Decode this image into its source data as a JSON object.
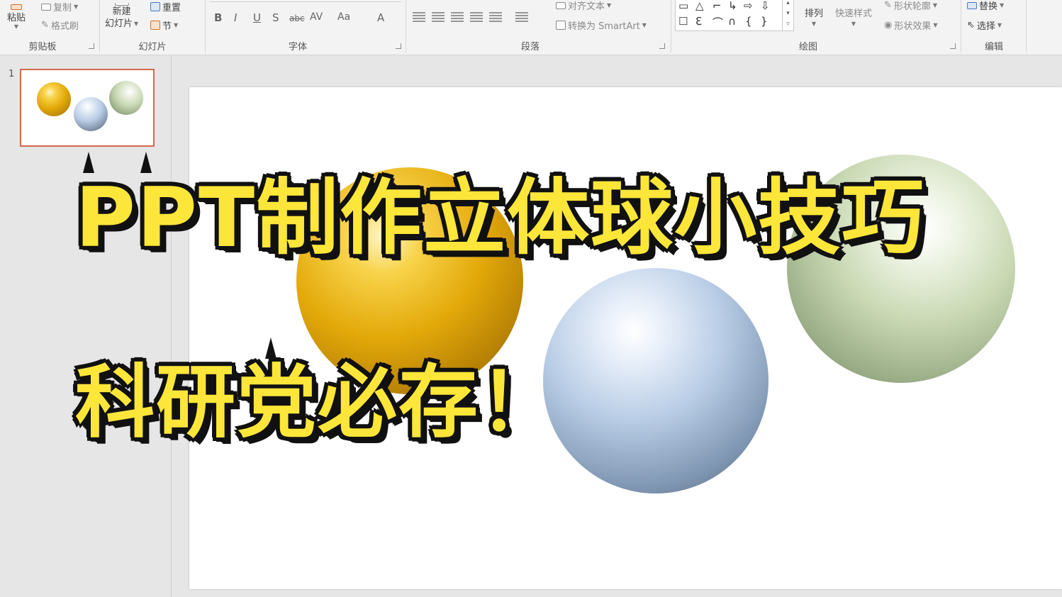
{
  "ribbon": {
    "clipboard": {
      "paste": "粘贴",
      "copy": "复制",
      "format_painter": "格式刷",
      "label": "剪贴板"
    },
    "slides": {
      "new_slide_line1": "新建",
      "new_slide_line2": "幻灯片",
      "reset": "重置",
      "section": "节",
      "label": "幻灯片"
    },
    "font": {
      "buttons": [
        "B",
        "I",
        "U",
        "S",
        "abc",
        "AV",
        "Aa",
        "A"
      ],
      "label": "字体"
    },
    "paragraph": {
      "align_text": "对齐文本",
      "convert_smartart": "转换为 SmartArt",
      "label": "段落"
    },
    "drawing": {
      "shapes_row1": [
        "▭",
        "△",
        "⌐",
        "↳",
        "⇨",
        "⇩"
      ],
      "shapes_row2": [
        "☐",
        "ℇ",
        "⌒",
        "∩",
        "{",
        "}"
      ],
      "arrange": "排列",
      "quick_styles": "快速样式",
      "shape_outline": "形状轮廓",
      "shape_effects": "形状效果",
      "label": "绘图"
    },
    "editing": {
      "replace": "替换",
      "select": "选择",
      "label": "编辑"
    }
  },
  "thumbnail_pane": {
    "slide_number": "1"
  },
  "colors": {
    "headline_fill": "#fde63a",
    "headline_stroke": "#111111",
    "thumb_selected_border": "#d2684f",
    "sphere_gold": "#e3a90a",
    "sphere_blue": "#b9cde6",
    "sphere_green": "#cad9b4"
  },
  "overlay": {
    "headline": "PPT制作立体球小技巧",
    "subline": "科研党必存！"
  }
}
